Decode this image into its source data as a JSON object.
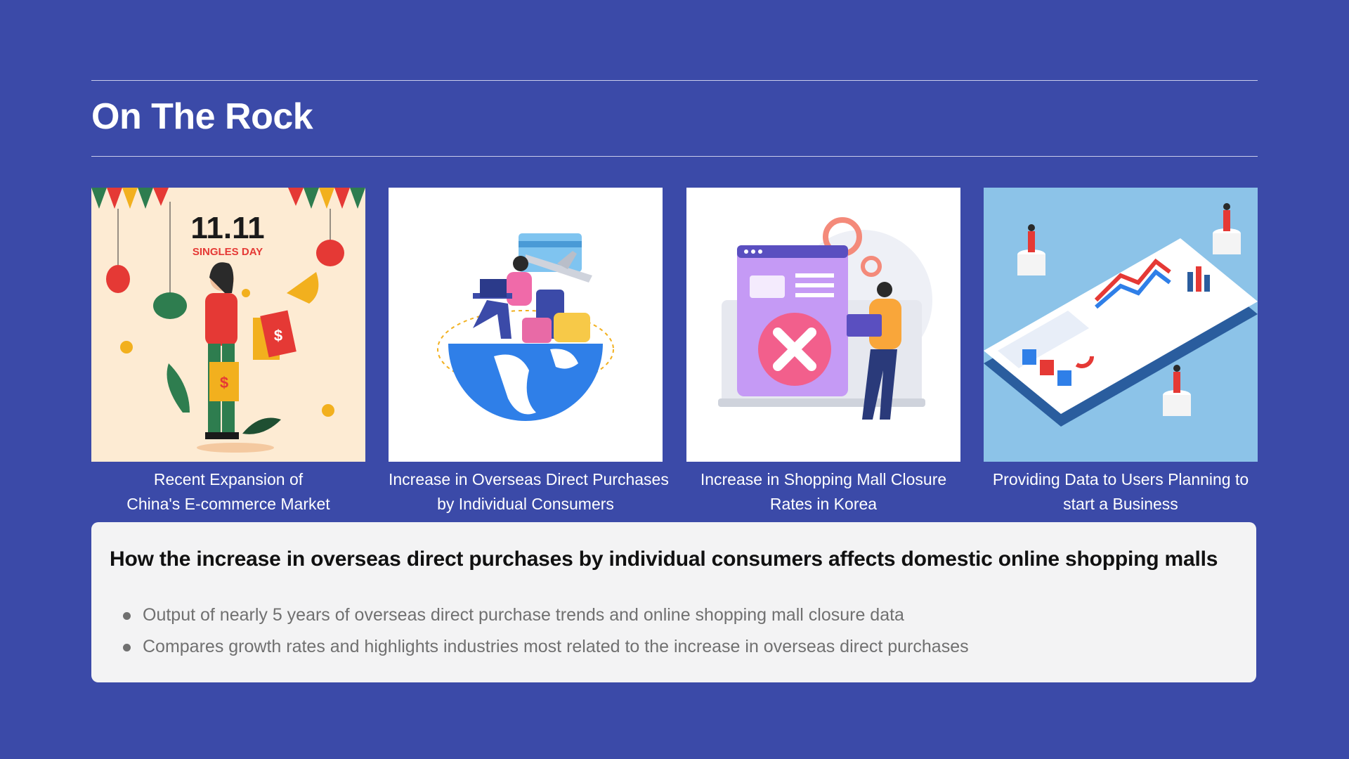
{
  "page": {
    "title": "On The Rock"
  },
  "cards": [
    {
      "image_label": "11.11",
      "image_sublabel": "SINGLES DAY",
      "caption_lines": [
        "Recent Expansion of",
        "China's E-commerce Market"
      ]
    },
    {
      "caption_lines": [
        "Increase in Overseas Direct Purchases",
        "by Individual Consumers"
      ]
    },
    {
      "caption_lines": [
        "Increase in Shopping Mall Closure",
        "Rates in Korea"
      ]
    },
    {
      "caption_lines": [
        "Providing Data to Users Planning to",
        "start a Business"
      ]
    }
  ],
  "detail": {
    "heading": "How the increase in overseas direct purchases by individual consumers affects domestic online shopping malls",
    "bullets": [
      "Output of nearly 5 years of overseas direct purchase trends and online shopping mall closure data",
      "Compares growth rates and highlights industries most related to the increase in overseas direct purchases"
    ]
  },
  "colors": {
    "background": "#3b4aa8",
    "panel": "#f3f3f4",
    "accent_red": "#e53935",
    "globe_blue": "#2f7fe8"
  },
  "icons": [
    "shopping-woman-illustration",
    "travel-globe-illustration",
    "closed-store-illustration",
    "isometric-dashboard-illustration"
  ]
}
